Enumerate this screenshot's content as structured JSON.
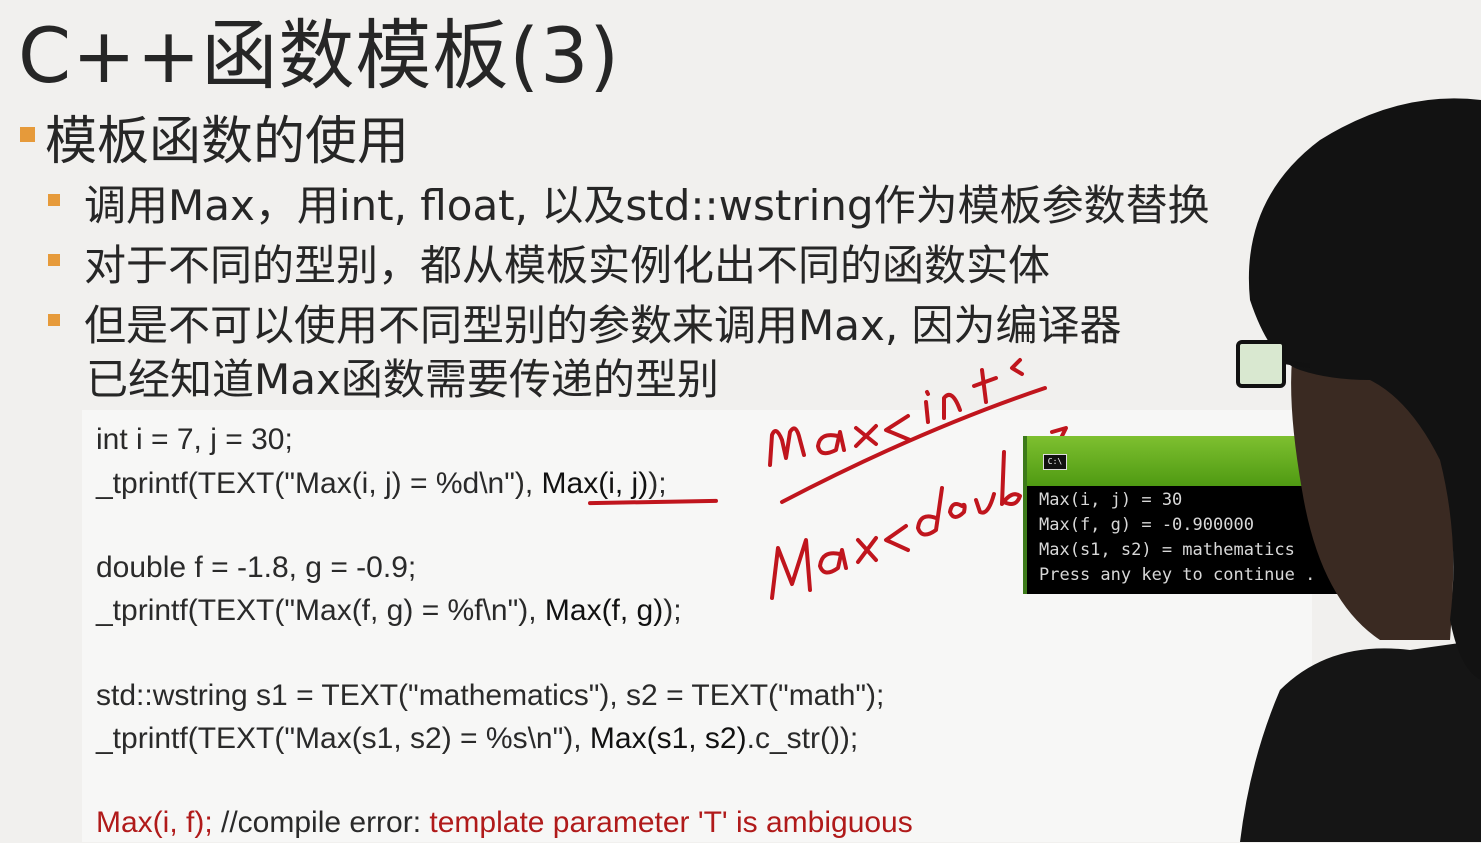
{
  "slide": {
    "title": "C++函数模板(3)",
    "heading": "模板函数的使用",
    "bullets": [
      "调用Max，用int, float, 以及std::wstring作为模板参数替换",
      "对于不同的型别，都从模板实例化出不同的函数实体",
      "但是不可以使用不同型别的参数来调用Max, 因为编译器"
    ],
    "bullet3_cont": "已经知道Max函数需要传递的型别"
  },
  "code": {
    "l1": "int i = 7, j = 30;",
    "l2_pre": "_tprintf(TEXT(\"Max(i, j) = %d\\n\"), ",
    "l2_call": "Max(i, j)",
    "l2_post": ");",
    "l3": "double f = -1.8, g = -0.9;",
    "l4_pre": "_tprintf(TEXT(\"Max(f, g) = %f\\n\"), ",
    "l4_call": "Max(f, g)",
    "l4_post": ");",
    "l5": "std::wstring s1 = TEXT(\"mathematics\"), s2 = TEXT(\"math\");",
    "l6_pre": "_tprintf(TEXT(\"Max(s1, s2) = %s\\n\"), ",
    "l6_call": "Max(s1, s2)",
    "l6_post": ".c_str());",
    "l7_red1": "Max(i, f);",
    "l7_mid": " //compile error: ",
    "l7_red2": "template parameter 'T' is ambiguous"
  },
  "annotations": {
    "ink1": "max<int>",
    "ink2": "Max<double>",
    "ink_color": "#c0151d"
  },
  "console": {
    "icon": "C:\\",
    "lines": [
      "Max(i, j) = 30",
      "Max(f, g) = -0.900000",
      "Max(s1, s2) = mathematics",
      "Press any key to continue . . ."
    ]
  },
  "colors": {
    "bullet": "#e69a3a",
    "error_red": "#b01a1a",
    "console_bar": "#6cb124"
  }
}
